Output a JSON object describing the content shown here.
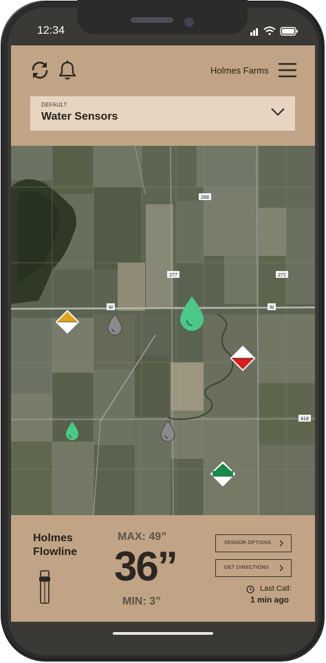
{
  "status_bar": {
    "time": "12:34"
  },
  "header": {
    "refresh_icon": "refresh-icon",
    "bell_icon": "bell-icon",
    "farm_name": "Holmes Farms",
    "menu_icon": "hamburger-menu-icon"
  },
  "selector": {
    "label": "DEFAULT",
    "value": "Water Sensors"
  },
  "map": {
    "road_labels": [
      "268",
      "277",
      "271",
      "W",
      "W",
      "418"
    ],
    "markers": [
      {
        "type": "diamond",
        "status": "warning",
        "color": "#e0a418"
      },
      {
        "type": "drop",
        "status": "offline",
        "color": "#8a8a8a"
      },
      {
        "type": "drop",
        "status": "selected",
        "color": "#4cc98a"
      },
      {
        "type": "diamond",
        "status": "alert",
        "color": "#d81e1e"
      },
      {
        "type": "drop",
        "status": "ok",
        "color": "#4cc98a"
      },
      {
        "type": "drop",
        "status": "offline",
        "color": "#8a8a8a"
      },
      {
        "type": "diamond",
        "status": "ok",
        "color": "#1a8a4a"
      }
    ]
  },
  "sensor": {
    "name": "Holmes Flowline",
    "max": "MAX: 49”",
    "reading": "36”",
    "min": "MIN: 3”"
  },
  "actions": {
    "sensor_options": "SENSOR OPTIONS",
    "get_directions": "GET DIRECTIONS"
  },
  "last_call": {
    "label": "Last Call:",
    "value": "1 min ago"
  },
  "colors": {
    "accent": "#c1a485",
    "selector_bg": "#e7d5c2",
    "dark": "#26211b"
  }
}
